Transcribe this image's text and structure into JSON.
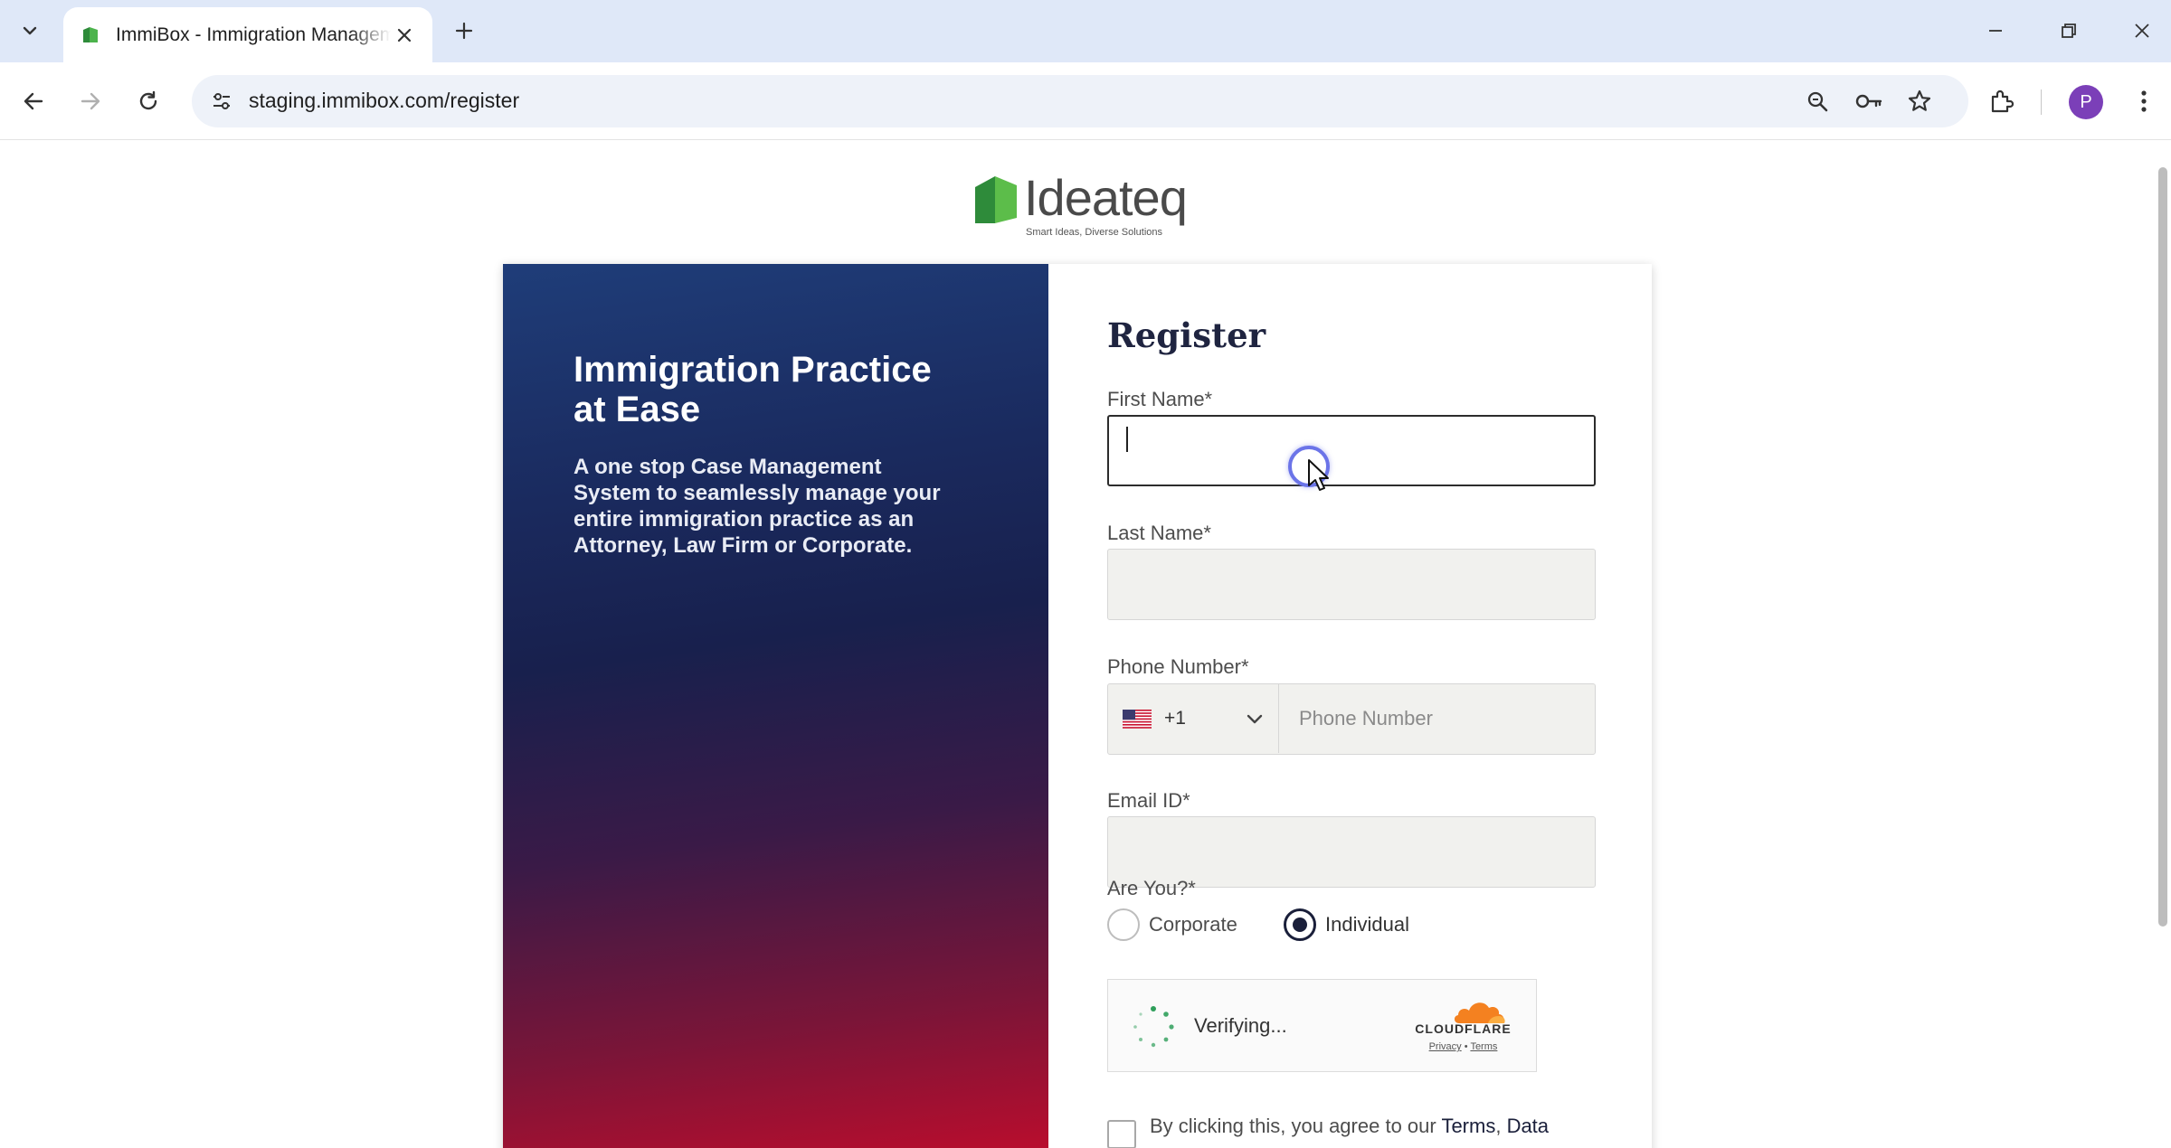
{
  "browser": {
    "tab_title": "ImmiBox - Immigration Management",
    "url": "staging.immibox.com/register",
    "profile_initial": "P"
  },
  "brand": {
    "logo_text": "Ideateq",
    "logo_tagline": "Smart Ideas, Diverse Solutions",
    "logo_green": "#3a9a3a"
  },
  "hero": {
    "title": "Immigration Practice at Ease",
    "description": "A one stop Case Management System to seamlessly manage your entire immigration practice as an Attorney, Law Firm or Corporate."
  },
  "form": {
    "title": "Register",
    "first_name_label": "First Name*",
    "first_name_value": "",
    "last_name_label": "Last Name*",
    "last_name_value": "",
    "phone_label": "Phone Number*",
    "country_code": "+1",
    "country_flag": "us-flag",
    "phone_placeholder": "Phone Number",
    "email_label": "Email ID*",
    "email_value": "",
    "role_label": "Are You?*",
    "role_options": [
      "Corporate",
      "Individual"
    ],
    "role_selected": "Individual",
    "captcha_status": "Verifying...",
    "captcha_brand": "CLOUDFLARE",
    "captcha_privacy": "Privacy",
    "captcha_terms": "Terms",
    "consent_text_prefix": "By clicking this, you agree to our ",
    "consent_link_terms": "Terms",
    "consent_link_data": "Data"
  },
  "colors": {
    "tabbar_bg": "#dfe8f8",
    "hero_top": "#1f3d79",
    "hero_bottom": "#c00c2c",
    "radio_accent": "#1a1f3a",
    "cloudflare_orange": "#f48120"
  }
}
